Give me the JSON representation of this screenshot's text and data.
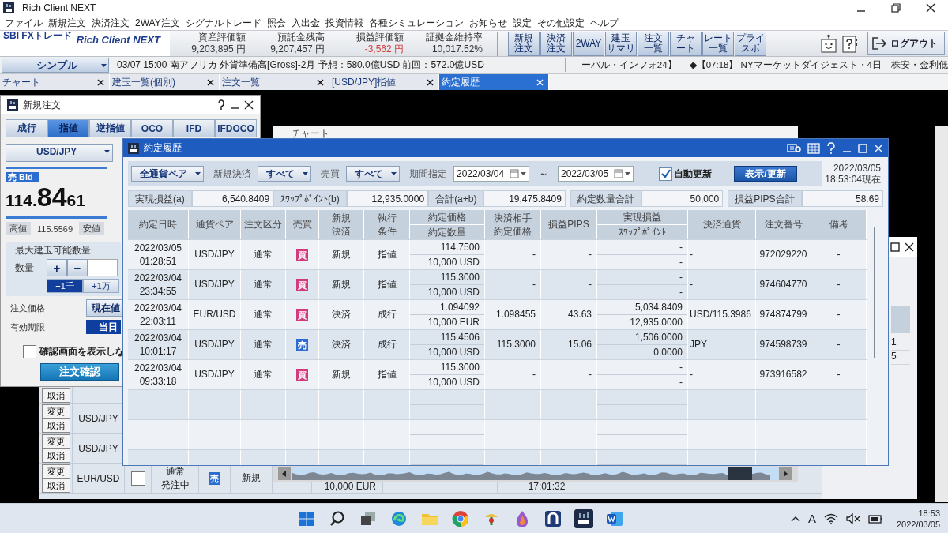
{
  "app": {
    "title": "Rich Client NEXT"
  },
  "menu": [
    "ファイル",
    "新規注文",
    "決済注文",
    "2WAY注文",
    "シグナルトレード",
    "照会",
    "入出金",
    "投資情報",
    "各種シミュレーション",
    "お知らせ",
    "設定",
    "その他設定",
    "ヘルプ"
  ],
  "header": {
    "brand": "SBI FXトレード",
    "product": "Rich Client NEXT",
    "metrics": [
      {
        "label": "資産評価額",
        "value": "9,203,895 円",
        "negative": false
      },
      {
        "label": "預託金残高",
        "value": "9,207,457 円",
        "negative": false
      },
      {
        "label": "損益評価額",
        "value": "-3,562 円",
        "negative": true
      },
      {
        "label": "証拠金維持率",
        "value": "10,017.52%",
        "negative": false
      }
    ],
    "shortcuts": [
      [
        "新規",
        "注文"
      ],
      [
        "決済",
        "注文"
      ],
      [
        "2WAY"
      ],
      [
        "建玉",
        "サマリ"
      ],
      [
        "注文",
        "一覧"
      ],
      [
        "チャ",
        "ート"
      ],
      [
        "レート",
        "一覧"
      ],
      [
        "プライ",
        "スボ"
      ]
    ],
    "logout": "ログアウト"
  },
  "ticker": {
    "view": "シンプル",
    "items": [
      {
        "text": "03/07 15:00 南アフリカ 外貨準備高[Gross]-2月 予想：580.0億USD 前回：572.0億USD",
        "link": false
      },
      {
        "text": "ーバル・インフォ24】",
        "link": true
      },
      {
        "text": "◆【07:18】 NYマーケットダイジェスト・4日　株安・金利低",
        "link": true
      }
    ]
  },
  "tabs": [
    {
      "label": "チャート",
      "selected": false
    },
    {
      "label": "建玉一覧(個別)",
      "selected": false
    },
    {
      "label": "注文一覧",
      "selected": false
    },
    {
      "label": "[USD/JPY]指値",
      "selected": false
    },
    {
      "label": "約定履歴",
      "selected": true
    }
  ],
  "order_window": {
    "title": "新規注文",
    "types": [
      {
        "label": "成行",
        "selected": false
      },
      {
        "label": "指値",
        "selected": true
      },
      {
        "label": "逆指値",
        "selected": false
      },
      {
        "label": "OCO",
        "selected": false
      },
      {
        "label": "IFD",
        "selected": false
      },
      {
        "label": "IFDOCO",
        "selected": false
      }
    ],
    "pair": "USD/JPY",
    "side_label": "売 Bid",
    "price": {
      "head": "114.",
      "pips": "84",
      "tail": "61"
    },
    "high_label": "高値",
    "high": "115.5569",
    "low_label": "安値",
    "max_label": "最大建玉可能数量",
    "qty_label": "数量",
    "plus": "+",
    "minus": "−",
    "steps": [
      {
        "label": "+1千",
        "selected": true
      },
      {
        "label": "+1万",
        "selected": false
      }
    ],
    "price_label": "注文価格",
    "price_mode": "現在値",
    "expiry_label": "有効期限",
    "expiry": "当日",
    "confirm_skip": {
      "label": "確認画面を表示しな",
      "checked": false
    },
    "submit": "注文確認"
  },
  "chart_window": {
    "title": "チャート"
  },
  "history": {
    "title": "約定履歴",
    "filters": {
      "pair": "全通貨ペア",
      "open_close_label": "新規決済",
      "open_close": "すべて",
      "side_label": "売買",
      "side": "すべて",
      "period_label": "期間指定",
      "from": "2022/03/04",
      "tilde": "～",
      "to": "2022/03/05",
      "auto_refresh": {
        "label": "自動更新",
        "checked": true
      },
      "refresh": "表示/更新",
      "as_of_date": "2022/03/05",
      "as_of_time": "18:53:04現在"
    },
    "summary": [
      {
        "label": "実現損益(a)",
        "value": "6,540.8409"
      },
      {
        "label": "ｽﾜｯﾌﾟﾎﾟｲﾝﾄ(b)",
        "value": "12,935.0000"
      },
      {
        "label": "合計(a+b)",
        "value": "19,475.8409"
      },
      {
        "label": "約定数量合計",
        "value": "50,000"
      },
      {
        "label": "損益PIPS合計",
        "value": "58.69"
      }
    ],
    "columns": [
      {
        "lines": [
          "約定日時"
        ]
      },
      {
        "lines": [
          "通貨ペア"
        ]
      },
      {
        "lines": [
          "注文区分"
        ]
      },
      {
        "lines": [
          "売買"
        ]
      },
      {
        "lines": [
          "新規",
          "決済"
        ]
      },
      {
        "lines": [
          "執行",
          "条件"
        ]
      },
      {
        "lines": [
          "約定価格"
        ],
        "sublabel": "約定数量"
      },
      {
        "lines": [
          "決済相手",
          "約定価格"
        ]
      },
      {
        "lines": [
          "損益PIPS"
        ]
      },
      {
        "lines": [
          "実現損益"
        ],
        "sublabel": "ｽﾜｯﾌﾟﾎﾟｲﾝﾄ"
      },
      {
        "lines": [
          "決済通貨"
        ]
      },
      {
        "lines": [
          "注文番号"
        ]
      },
      {
        "lines": [
          "備考"
        ]
      }
    ],
    "rows": [
      {
        "datetime": "2022/03/05 01:28:51",
        "pair": "USD/JPY",
        "order_type": "通常",
        "side_label": "買",
        "color": "#d33a7d",
        "open_close": "新規",
        "execution": "指値",
        "price": "114.7500",
        "quantity": "10,000 USD",
        "counter_price": "-",
        "pips": "-",
        "pnl": "-",
        "swap": "-",
        "settle": "-",
        "order_no": "972029220",
        "note": "-"
      },
      {
        "datetime": "2022/03/04 23:34:55",
        "pair": "USD/JPY",
        "order_type": "通常",
        "side_label": "買",
        "color": "#d33a7d",
        "open_close": "新規",
        "execution": "指値",
        "price": "115.3000",
        "quantity": "10,000 USD",
        "counter_price": "-",
        "pips": "-",
        "pnl": "-",
        "swap": "-",
        "settle": "-",
        "order_no": "974604770",
        "note": "-"
      },
      {
        "datetime": "2022/03/04 22:03:11",
        "pair": "EUR/USD",
        "order_type": "通常",
        "side_label": "買",
        "color": "#d33a7d",
        "open_close": "決済",
        "execution": "成行",
        "price": "1.094092",
        "quantity": "10,000 EUR",
        "counter_price": "1.098455",
        "pips": "43.63",
        "pnl": "5,034.8409",
        "swap": "12,935.0000",
        "settle": "USD/115.3986",
        "order_no": "974874799",
        "note": "-"
      },
      {
        "datetime": "2022/03/04 10:01:17",
        "pair": "USD/JPY",
        "order_type": "通常",
        "side_label": "売",
        "color": "#2a6ccf",
        "open_close": "決済",
        "execution": "成行",
        "price": "115.4506",
        "quantity": "10,000 USD",
        "counter_price": "115.3000",
        "pips": "15.06",
        "pnl": "1,506.0000",
        "swap": "0.0000",
        "settle": "JPY",
        "order_no": "974598739",
        "note": "-"
      },
      {
        "datetime": "2022/03/04 09:33:18",
        "pair": "USD/JPY",
        "order_type": "通常",
        "side_label": "買",
        "color": "#d33a7d",
        "open_close": "新規",
        "execution": "指値",
        "price": "115.3000",
        "quantity": "10,000 USD",
        "counter_price": "-",
        "pips": "-",
        "pnl": "-",
        "swap": "-",
        "settle": "-",
        "order_no": "973916582",
        "note": "-"
      }
    ]
  },
  "orders_window": {
    "rows": [
      {
        "actions": [
          "取消"
        ]
      },
      {
        "actions": [
          "変更",
          "取消"
        ],
        "pair": "USD/JPY"
      },
      {
        "actions": [
          "変更",
          "取消"
        ],
        "pair": "USD/JPY"
      },
      {
        "actions": [
          "変更",
          "取消"
        ],
        "pair": "EUR/USD",
        "checked": false,
        "order_type": "通常",
        "status": "発注中",
        "side_label": "売",
        "color": "#2a6ccf",
        "open_close": "新規",
        "quantity": "10,000 EUR",
        "time": "17:01:32"
      }
    ]
  },
  "side_window": {
    "cells": [
      "1",
      "5"
    ]
  },
  "taskbar": {
    "ime": "A",
    "time": "18:53",
    "date": "2022/03/05"
  }
}
